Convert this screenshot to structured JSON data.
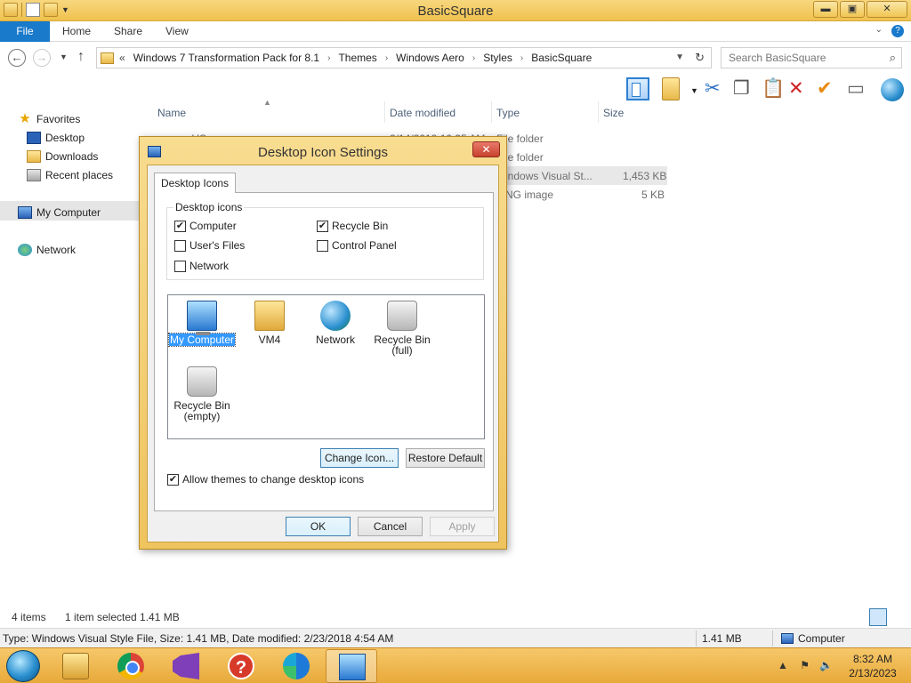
{
  "window": {
    "title": "BasicSquare",
    "controls": {
      "minimize": "▬",
      "maximize": "▣",
      "close": "✕"
    }
  },
  "ribbon": {
    "tabs": [
      {
        "label": "File",
        "active": true
      },
      {
        "label": "Home"
      },
      {
        "label": "Share"
      },
      {
        "label": "View"
      }
    ],
    "right": {
      "expand": "⌄",
      "help": "?"
    }
  },
  "address": {
    "prefix": "«",
    "crumbs": [
      "Windows 7 Transformation Pack for 8.1",
      "Themes",
      "Windows Aero",
      "Styles",
      "BasicSquare"
    ],
    "separator": "›",
    "search_placeholder": "Search BasicSquare"
  },
  "toolbar": {
    "icons": [
      "preview-pane-icon",
      "change-view-icon",
      "cut-icon",
      "copy-icon",
      "paste-icon",
      "delete-icon",
      "select-icon",
      "rename-icon",
      "globe-icon"
    ]
  },
  "navpane": {
    "favorites": "Favorites",
    "items": [
      "Desktop",
      "Downloads",
      "Recent places"
    ],
    "computer": "My Computer",
    "network": "Network"
  },
  "filelist": {
    "columns": [
      "Name",
      "Date modified",
      "Type",
      "Size"
    ],
    "rows": [
      {
        "name": "en-US",
        "date": "2/14/2019 10:35 AM",
        "type": "File folder",
        "size": ""
      },
      {
        "name": "",
        "date": "",
        "type": "File folder",
        "size": ""
      },
      {
        "name": "",
        "date": "",
        "type": "Windows Visual St...",
        "size": "1,453 KB",
        "selected": true
      },
      {
        "name": "",
        "date": "",
        "type": "PNG image",
        "size": "5 KB"
      }
    ],
    "visible": {
      "row0_name": "en-US",
      "row0_date": "2/14/2019 10:35 AM",
      "row0_type": "File folder",
      "row1_type": "File folder",
      "row2_type": "indows Visual St...",
      "row2_size": "1,453 KB",
      "row3_type": "NG image",
      "row3_size": "5 KB"
    }
  },
  "dialog": {
    "title": "Desktop Icon Settings",
    "close": "✕",
    "tab": "Desktop Icons",
    "group_label": "Desktop icons",
    "checkboxes": [
      {
        "label": "Computer",
        "checked": true
      },
      {
        "label": "Recycle Bin",
        "checked": true
      },
      {
        "label": "User's Files",
        "checked": false
      },
      {
        "label": "Control Panel",
        "checked": false
      },
      {
        "label": "Network",
        "checked": false
      }
    ],
    "icons": [
      {
        "label": "My Computer",
        "selected": true
      },
      {
        "label": "VM4"
      },
      {
        "label": "Network"
      },
      {
        "label": "Recycle Bin (full)"
      },
      {
        "label": "Recycle Bin (empty)"
      }
    ],
    "icon_labels": {
      "my_computer": "My Computer",
      "vm4": "VM4",
      "network": "Network",
      "bin_full_1": "Recycle Bin",
      "bin_full_2": "(full)",
      "bin_empty_1": "Recycle Bin",
      "bin_empty_2": "(empty)"
    },
    "change_icon": "Change Icon...",
    "restore_default": "Restore Default",
    "allow_themes": "Allow themes to change desktop icons",
    "allow_themes_checked": true,
    "ok": "OK",
    "cancel": "Cancel",
    "apply": "Apply"
  },
  "status": {
    "items": "4 items",
    "selected": "1 item selected  1.41 MB"
  },
  "details": {
    "info": "Type: Windows Visual Style File, Size: 1.41 MB, Date modified: 2/23/2018 4:54 AM",
    "size": "1.41 MB",
    "location": "Computer"
  },
  "taskbar": {
    "apps": [
      "file-explorer",
      "chrome",
      "visual-studio",
      "help",
      "edge",
      "theme-app"
    ],
    "time": "8:32 AM",
    "date": "2/13/2023"
  },
  "check_mark": "✔"
}
